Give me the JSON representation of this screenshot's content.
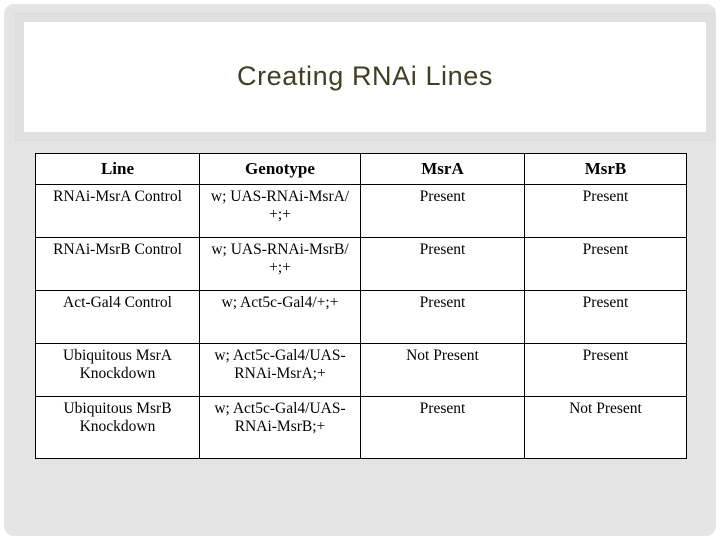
{
  "slide": {
    "title": "Creating RNAi Lines",
    "title_color": "#3f3f22",
    "background_color": "#e4e4e4"
  },
  "table": {
    "headers": [
      "Line",
      "Genotype",
      "MsrA",
      "MsrB"
    ],
    "rows": [
      {
        "line": "RNAi-MsrA Control",
        "genotype": "w; UAS-RNAi-MsrA/ +;+",
        "msra": "Present",
        "msrb": "Present"
      },
      {
        "line": "RNAi-MsrB Control",
        "genotype": "w; UAS-RNAi-MsrB/ +;+",
        "msra": "Present",
        "msrb": "Present"
      },
      {
        "line": "Act-Gal4 Control",
        "genotype": "w; Act5c-Gal4/+;+",
        "msra": "Present",
        "msrb": "Present"
      },
      {
        "line": "Ubiquitous MsrA Knockdown",
        "genotype": "w; Act5c-Gal4/UAS-RNAi-MsrA;+",
        "msra": "Not Present",
        "msrb": "Present"
      },
      {
        "line": "Ubiquitous MsrB Knockdown",
        "genotype": "w; Act5c-Gal4/UAS-RNAi-MsrB;+",
        "msra": "Present",
        "msrb": "Not Present"
      }
    ]
  }
}
